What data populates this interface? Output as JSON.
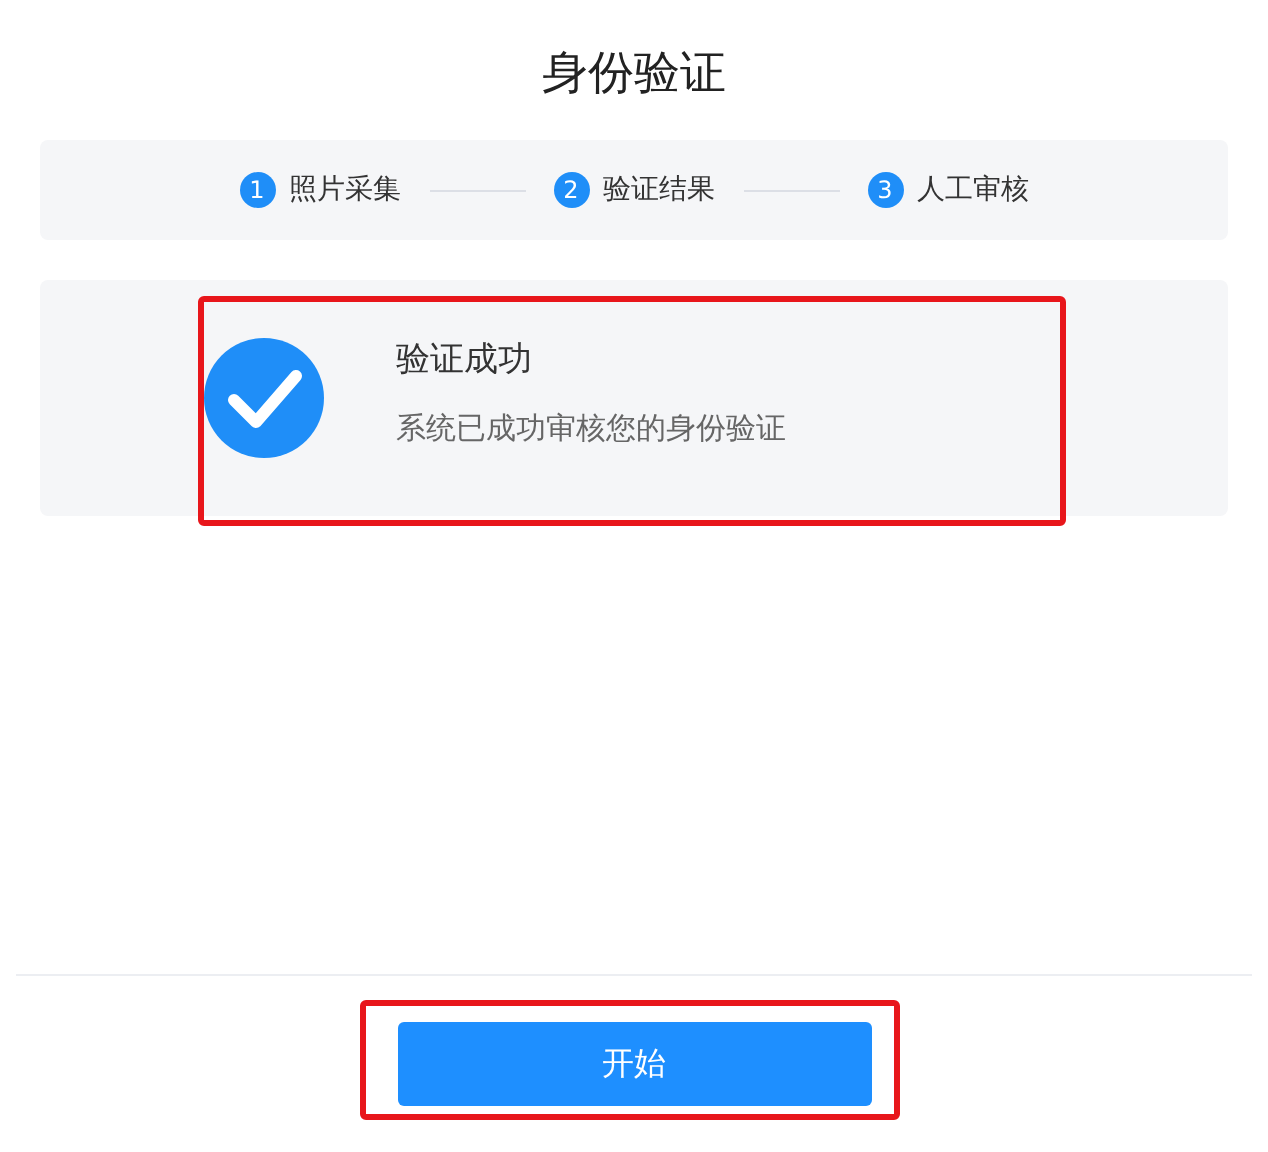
{
  "title": "身份验证",
  "steps": [
    {
      "number": "1",
      "label": "照片采集"
    },
    {
      "number": "2",
      "label": "验证结果"
    },
    {
      "number": "3",
      "label": "人工审核"
    }
  ],
  "result": {
    "heading": "验证成功",
    "message": "系统已成功审核您的身份验证",
    "highlighted": true
  },
  "start_button": {
    "label": "开始",
    "highlighted": true
  }
}
